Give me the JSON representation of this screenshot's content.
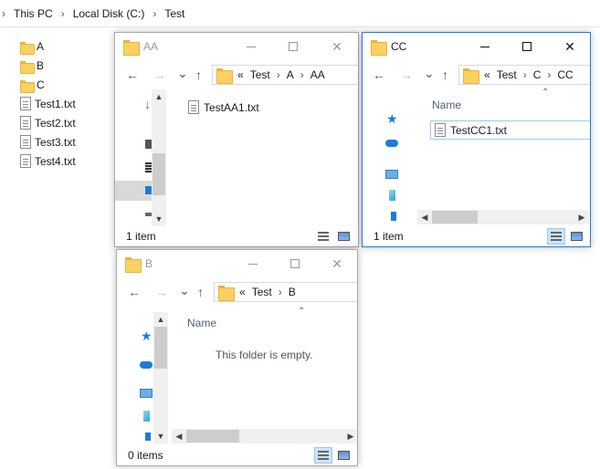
{
  "background": {
    "breadcrumb": [
      "This PC",
      "Local Disk (C:)",
      "Test"
    ],
    "items": [
      {
        "name": "A",
        "type": "folder"
      },
      {
        "name": "B",
        "type": "folder"
      },
      {
        "name": "C",
        "type": "folder"
      },
      {
        "name": "Test1.txt",
        "type": "file"
      },
      {
        "name": "Test2.txt",
        "type": "file"
      },
      {
        "name": "Test3.txt",
        "type": "file"
      },
      {
        "name": "Test4.txt",
        "type": "file"
      }
    ]
  },
  "windows": {
    "aa": {
      "title": "AA",
      "address": [
        "«",
        "Test",
        "A",
        "AA"
      ],
      "files": [
        "TestAA1.txt"
      ],
      "status": "1 item"
    },
    "cc": {
      "title": "CC",
      "address": [
        "«",
        "Test",
        "C",
        "CC"
      ],
      "column_header": "Name",
      "files": [
        "TestCC1.txt"
      ],
      "status": "1 item"
    },
    "b": {
      "title": "B",
      "address": [
        "«",
        "Test",
        "B"
      ],
      "column_header": "Name",
      "empty_message": "This folder is empty.",
      "status": "0 items"
    }
  },
  "icons": {
    "back": "←",
    "forward": "→",
    "recent": "⌄",
    "up": "↑",
    "minimize": "minimize-icon",
    "maximize": "maximize-icon",
    "close": "✕",
    "chevron": "›",
    "sort": "⌃"
  },
  "colors": {
    "active_border": "#1c7cd6",
    "folder": "#fcd063",
    "selection": "#cce4f7"
  }
}
